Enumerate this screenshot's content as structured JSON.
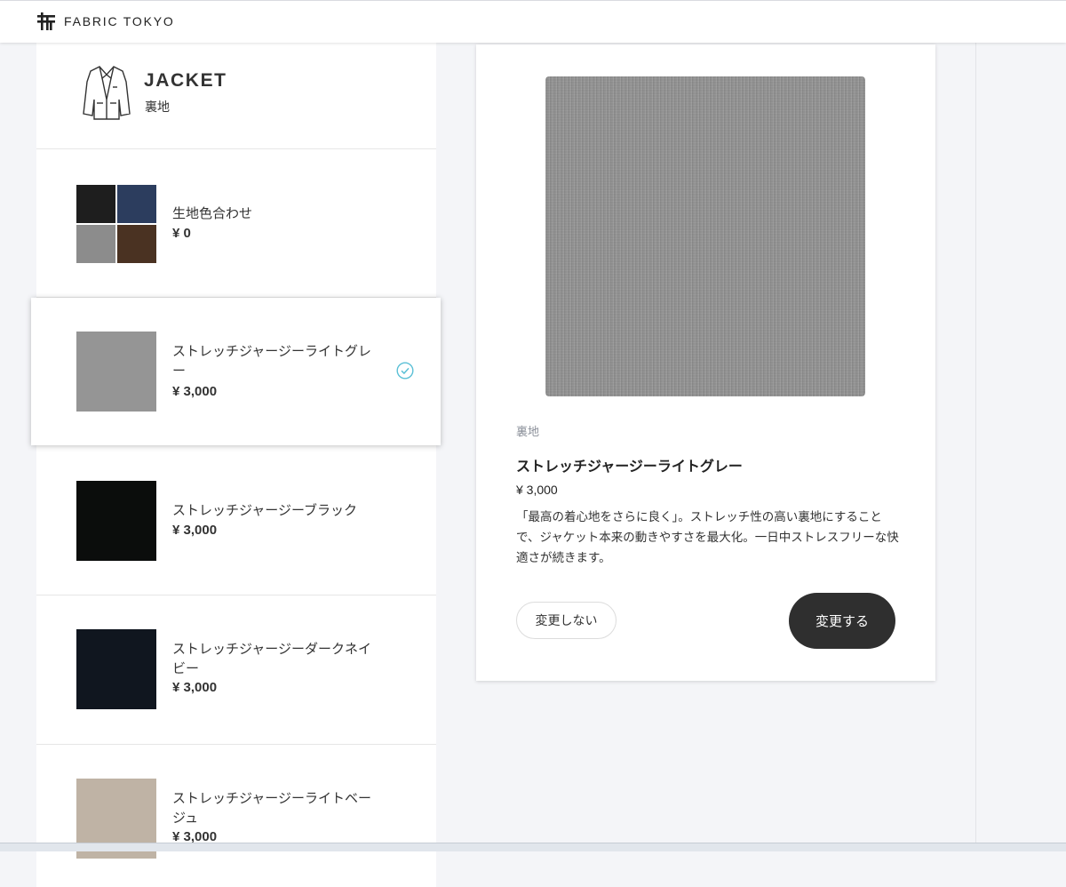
{
  "header": {
    "brand": "FABRIC TOKYO",
    "logo_icon": "fabric-tokyo-logo-icon"
  },
  "panel": {
    "title": "JACKET",
    "subtitle": "裏地",
    "icon": "jacket-icon"
  },
  "options": [
    {
      "name": "生地色合わせ",
      "price": "¥ 0",
      "swatch": "combo",
      "selected": false
    },
    {
      "name": "ストレッチジャージーライトグレー",
      "price": "¥ 3,000",
      "swatch_color": "#959595",
      "selected": true
    },
    {
      "name": "ストレッチジャージーブラック",
      "price": "¥ 3,000",
      "swatch_color": "#0b0d0c",
      "selected": false
    },
    {
      "name": "ストレッチジャージーダークネイビー",
      "price": "¥ 3,000",
      "swatch_color": "#10161f",
      "selected": false
    },
    {
      "name": "ストレッチジャージーライトベージュ",
      "price": "¥ 3,000",
      "swatch_color": "#bfb3a5",
      "selected": false
    }
  ],
  "combo_colors": [
    "#1e1e1e",
    "#2c3d5e",
    "#8c8c8c",
    "#4a3222"
  ],
  "detail": {
    "category": "裏地",
    "name": "ストレッチジャージーライトグレー",
    "price": "¥ 3,000",
    "description": "「最高の着心地をさらに良く」。ストレッチ性の高い裏地にすることで、ジャケット本来の動きやすさを最大化。一日中ストレスフリーな快適さが続きます。",
    "cancel_label": "変更しない",
    "confirm_label": "変更する"
  },
  "colors": {
    "accent_check": "#5bc0d6",
    "confirm_button": "#2f2f2f",
    "page_bg": "#f4f5f8"
  }
}
